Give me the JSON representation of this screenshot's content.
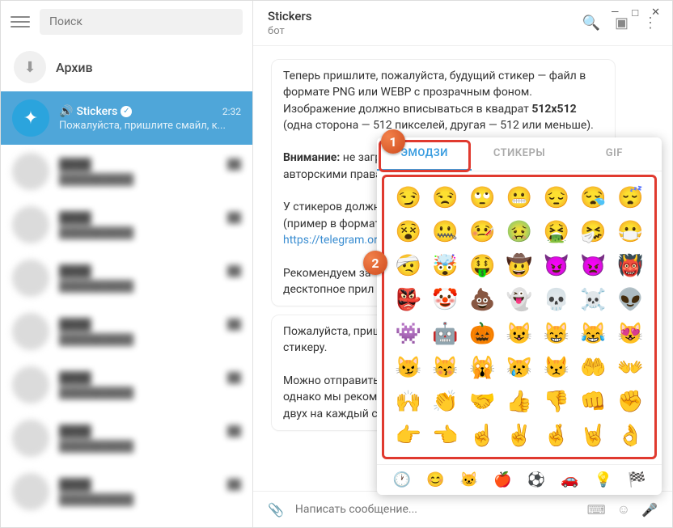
{
  "window_controls": {
    "min": "—",
    "max": "□",
    "close": "✕"
  },
  "sidebar": {
    "search_placeholder": "Поиск",
    "archive_label": "Архив",
    "active_chat": {
      "name": "Stickers",
      "time": "2:32",
      "preview": "Пожалуйста, пришлите смайл, к..."
    }
  },
  "header": {
    "title": "Stickers",
    "subtitle": "бот"
  },
  "messages": {
    "m1_a": "Теперь пришлите, пожалуйста, будущий стикер — файл в формате PNG или WEBP с прозрачным фоном. Изображение должно вписываться в квадрат ",
    "m1_b": "512x512",
    "m1_c": " (одна сторона — 512 пикселей, другая — 512 или меньше).",
    "m2_a": "Внимание:",
    "m2_b": " не загружайте",
    "m2_c": " авторскими правами",
    "m3_a": "У стикеров должна б",
    "m3_b": "(пример в формате P",
    "m3_c": "https://telegram.org/i",
    "m4_a": "Рекомендуем за",
    "m4_b": "десктопное прил",
    "m5_a": "Пожалуйста, пришли",
    "m5_b": " стикеру.",
    "m6_a": "Можно отправить не",
    "m6_b": "однако мы рекоменд",
    "m6_c": "двух на каждый стик"
  },
  "input_placeholder": "Написать сообщение...",
  "emoji_panel": {
    "tabs": {
      "emoji": "ЭМОДЗИ",
      "stickers": "СТИКЕРЫ",
      "gif": "GIF"
    },
    "rows": [
      [
        "😏",
        "😒",
        "🙄",
        "😬",
        "😔",
        "😪",
        "😴"
      ],
      [
        "😵",
        "🤐",
        "🤒",
        "🤢",
        "🤮",
        "🤧",
        "😷"
      ],
      [
        "🤕",
        "🤯",
        "🤑",
        "🤠",
        "😈",
        "👿",
        "👹"
      ],
      [
        "👺",
        "🤡",
        "💩",
        "👻",
        "💀",
        "☠️",
        "👽"
      ],
      [
        "👾",
        "🤖",
        "🎃",
        "😺",
        "😸",
        "😹",
        "😻"
      ],
      [
        "😼",
        "😽",
        "🙀",
        "😿",
        "😾",
        "🤲",
        "👐"
      ],
      [
        "🙌",
        "👏",
        "🤝",
        "👍",
        "👎",
        "👊",
        "✊"
      ],
      [
        "👉",
        "👈",
        "☝️",
        "✌️",
        "🤞",
        "🤘",
        "👌"
      ]
    ],
    "categories": [
      "🕐",
      "😊",
      "🐱",
      "🍎",
      "⚽",
      "🚗",
      "💡",
      "🏁"
    ]
  },
  "callouts": {
    "one": "1",
    "two": "2"
  }
}
